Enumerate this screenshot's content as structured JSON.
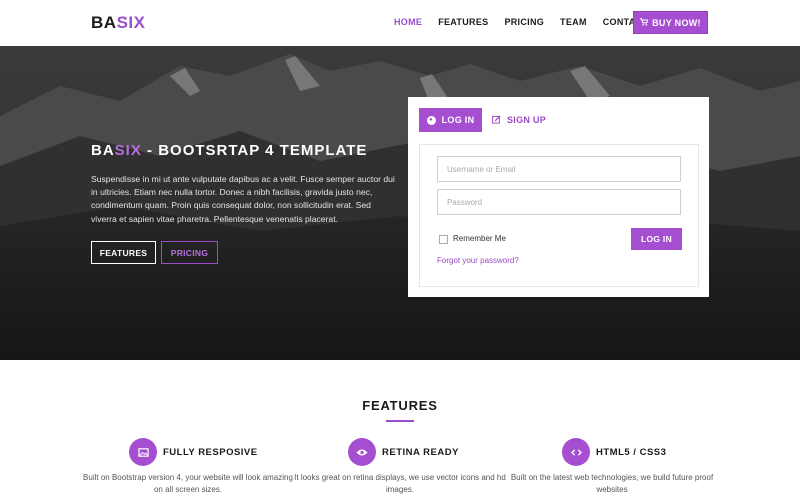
{
  "brand": {
    "prefix": "BA",
    "accent": "SIX"
  },
  "nav": {
    "items": [
      {
        "label": "HOME",
        "active": true
      },
      {
        "label": "FEATURES",
        "active": false
      },
      {
        "label": "PRICING",
        "active": false
      },
      {
        "label": "TEAM",
        "active": false
      },
      {
        "label": "CONTACT",
        "active": false
      }
    ],
    "buy_label": "BUY NOW!"
  },
  "hero": {
    "title_prefix": "BA",
    "title_accent": "SIX",
    "title_rest": " - BOOTSRTAP 4 TEMPLATE",
    "text": "Suspendisse in mi ut ante vulputate dapibus ac a velit. Fusce semper auctor dui in ultricies. Etiam nec nulla tortor. Donec a nibh facilisis, gravida justo nec, condimentum quam. Proin quis consequat dolor, non sollicitudin erat. Sed viverra et sapien vitae pharetra. Pellentesque venenatis placerat.",
    "btn_features": "FEATURES",
    "btn_pricing": "PRICING"
  },
  "login": {
    "tab_login": "LOG IN",
    "tab_signup": "SIGN UP",
    "username_placeholder": "Username or Email",
    "password_placeholder": "Password",
    "remember_label": "Remember Me",
    "submit_label": "LOG IN",
    "forgot_label": "Forgot your password?"
  },
  "features": {
    "section_title": "FEATURES",
    "items": [
      {
        "icon": "image-icon",
        "title": "FULLY RESPOSIVE",
        "desc": "Built on Bootstrap version 4, your website will look amazing on all screen sizes."
      },
      {
        "icon": "eye-icon",
        "title": "RETINA READY",
        "desc": "It looks great on retina displays, we use vector icons and hd images."
      },
      {
        "icon": "code-icon",
        "title": "HTML5 / CSS3",
        "desc": "Built on the latest web technologies, we build future proof websites"
      }
    ]
  },
  "colors": {
    "accent": "#9b4dca",
    "button": "#a54ecf",
    "hero_bg": "#242424"
  }
}
